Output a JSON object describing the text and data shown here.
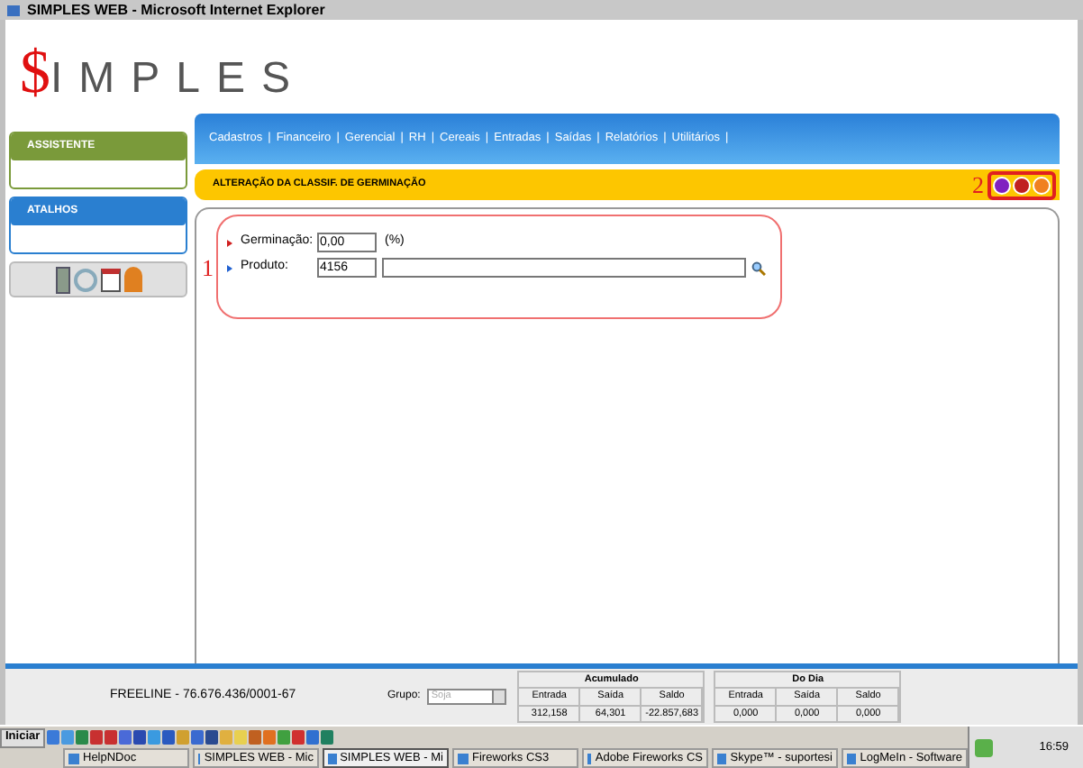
{
  "window": {
    "title": "SIMPLES WEB - Microsoft Internet Explorer"
  },
  "logo": {
    "mark": "$",
    "text": "IMPLES"
  },
  "menu": {
    "separator": "|",
    "items": [
      "Cadastros",
      "Financeiro",
      "Gerencial",
      "RH",
      "Cereais",
      "Entradas",
      "Saídas",
      "Relatórios",
      "Utilitários"
    ]
  },
  "sidebar": {
    "panels": [
      {
        "title": "ASSISTENTE",
        "color": "#7a9a3a"
      },
      {
        "title": "ATALHOS",
        "color": "#2a7fd0"
      }
    ]
  },
  "form": {
    "title": "ALTERAÇÃO DA CLASSIF. DE GERMINAÇÃO",
    "actions_marker": "2",
    "fields_marker": "1",
    "fields": [
      {
        "label": "Germinação:",
        "value": "0,00",
        "unit": "(%)",
        "color": "#d02020"
      },
      {
        "label": "Produto:",
        "value": "4156",
        "kind": "lookup",
        "color": "#2060d0"
      }
    ]
  },
  "footer": {
    "company": "FREELINE - 76.676.436/0001-67",
    "group_label": "Grupo:",
    "group_value": "Soja",
    "tables": [
      {
        "title": "Acumulado",
        "columns": [
          "Entrada",
          "Saída",
          "Saldo"
        ],
        "values": [
          "312,158",
          "64,301",
          "-22.857,683"
        ]
      },
      {
        "title": "Do Dia",
        "columns": [
          "Entrada",
          "Saída",
          "Saldo"
        ],
        "values": [
          "0,000",
          "0,000",
          "0,000"
        ]
      }
    ]
  },
  "taskbar": {
    "start": "Iniciar",
    "clock": "16:59",
    "tasks": [
      {
        "label": "HelpNDoc",
        "selected": false
      },
      {
        "label": "SIMPLES WEB - Mic",
        "selected": false
      },
      {
        "label": "SIMPLES WEB - Mi",
        "selected": true
      },
      {
        "label": "Fireworks CS3",
        "selected": false
      },
      {
        "label": "Adobe Fireworks CS",
        "selected": false
      },
      {
        "label": "Skype™ - suportesi",
        "selected": false
      },
      {
        "label": "LogMeIn - Software",
        "selected": false
      }
    ]
  }
}
